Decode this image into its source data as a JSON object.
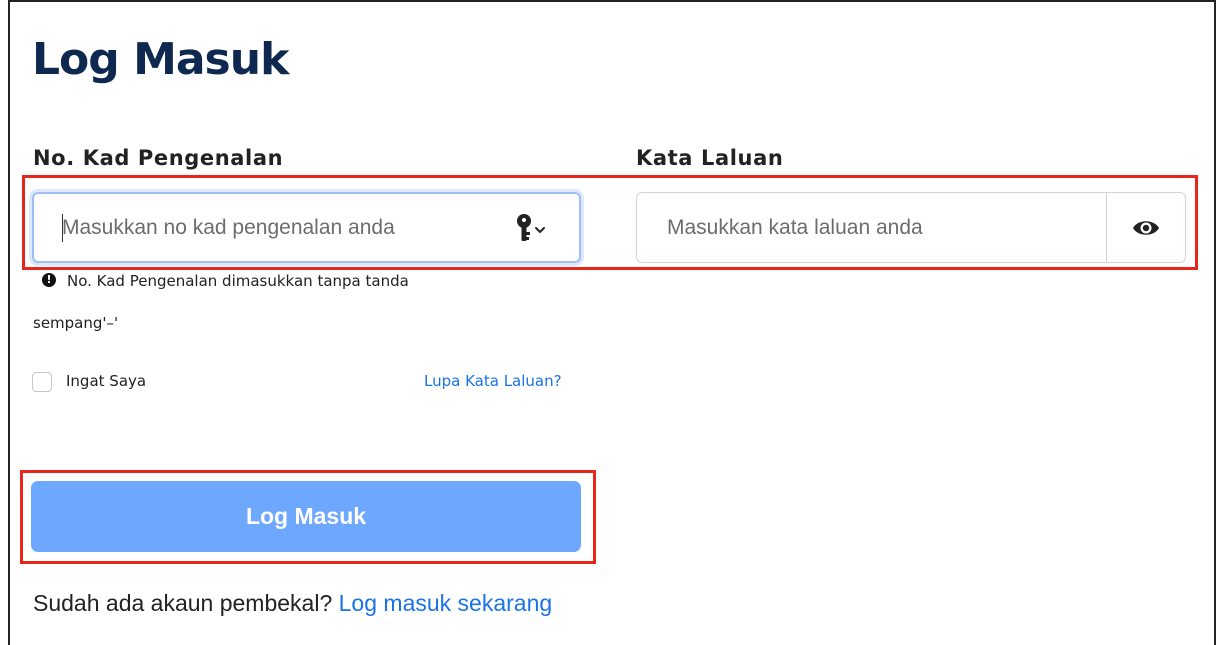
{
  "page": {
    "title": "Log Masuk"
  },
  "form": {
    "ic": {
      "label": "No. Kad Pengenalan",
      "placeholder": "Masukkan no kad pengenalan anda",
      "value": "",
      "hint_line1": "No. Kad Pengenalan dimasukkan tanpa tanda",
      "hint_line2": "sempang'–'",
      "trailing_icon": "key-icon"
    },
    "password": {
      "label": "Kata Laluan",
      "placeholder": "Masukkan kata laluan anda",
      "value": "",
      "toggle_icon": "eye-icon"
    },
    "remember_me": {
      "label": "Ingat Saya",
      "checked": false
    },
    "forgot_password": "Lupa Kata Laluan?",
    "submit_label": "Log Masuk"
  },
  "footer": {
    "prompt": "Sudah ada akaun pembekal?",
    "link": "Log masuk sekarang"
  },
  "colors": {
    "title": "#0e2850",
    "highlight": "#e8261c",
    "button": "#6ea8fe",
    "link": "#1a73e8"
  }
}
